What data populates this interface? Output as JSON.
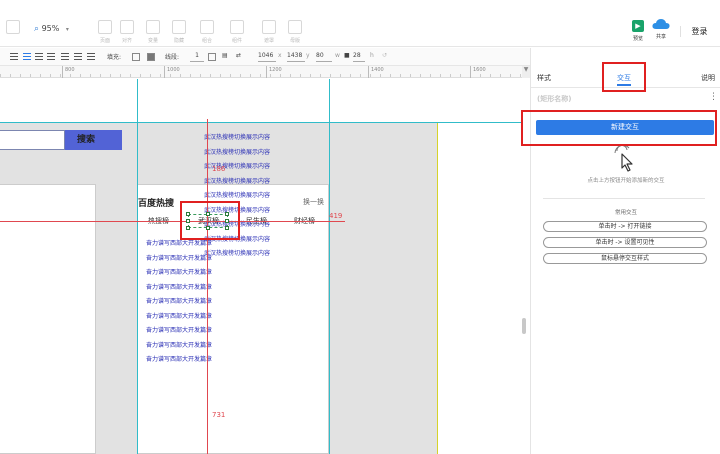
{
  "toolbar": {
    "zoom_value": "95%",
    "faint_labels": [
      "页面",
      "对齐",
      "变量",
      "隐藏",
      "组合",
      "组件",
      "遮罩",
      "母版"
    ],
    "preview_label": "预览",
    "share_label": "共享",
    "login_label": "登录"
  },
  "format_bar": {
    "fill_label": "填充:",
    "line_label": "线段:",
    "line_width": "1",
    "x_value": "1046",
    "x_label": "x",
    "y_value": "1438",
    "y_label": "y",
    "w_value": "80",
    "w_label": "w",
    "h_value": "28",
    "h_label": "h"
  },
  "ruler": {
    "marks": [
      "800",
      "1000",
      "1200",
      "1400",
      "1600"
    ]
  },
  "canvas": {
    "search_button_label": "搜索",
    "hot_title": "百度热搜",
    "hot_more": "换一换",
    "tabs": [
      "热搜榜",
      "武汉榜",
      "民生榜",
      "财经榜"
    ],
    "active_tab": "武汉榜",
    "left_list": [
      "奋力谱写西部大开发篇章",
      "奋力谱写西部大开发篇章",
      "奋力谱写西部大开发篇章",
      "奋力谱写西部大开发篇章",
      "奋力谱写西部大开发篇章",
      "奋力谱写西部大开发篇章",
      "奋力谱写西部大开发篇章",
      "奋力谱写西部大开发篇章",
      "奋力谱写西部大开发篇章"
    ],
    "right_list": [
      "武汉热搜榜切换展示内容",
      "武汉热搜榜切换展示内容",
      "武汉热搜榜切换展示内容",
      "武汉热搜榜切换展示内容",
      "武汉热搜榜切换展示内容",
      "武汉热搜榜切换展示内容",
      "武汉热搜榜切换展示内容",
      "武汉热搜榜切换展示内容",
      "武汉热搜榜切换展示内容"
    ],
    "dim_top": "186",
    "dim_left": "419",
    "dim_bottom": "731"
  },
  "right_panel": {
    "tabs": [
      "样式",
      "交互",
      "说明"
    ],
    "active_tab": "交互",
    "widget_name": "(矩形名称)",
    "more_icon": "⋮",
    "new_interaction_label": "新建交互",
    "hint": "点击上方按钮开始添加新的交互",
    "common_title": "常用交互",
    "presets": [
      "单击时 -> 打开链接",
      "单击时 -> 设置可见性",
      "鼠标悬停交互样式"
    ]
  },
  "colors": {
    "accent": "#2d7be5",
    "highlight": "#e02020",
    "guide": "#e0484f",
    "guide_cyan": "#31bcc9",
    "search_button": "#5263d6",
    "list_text": "#2a2fb5"
  }
}
